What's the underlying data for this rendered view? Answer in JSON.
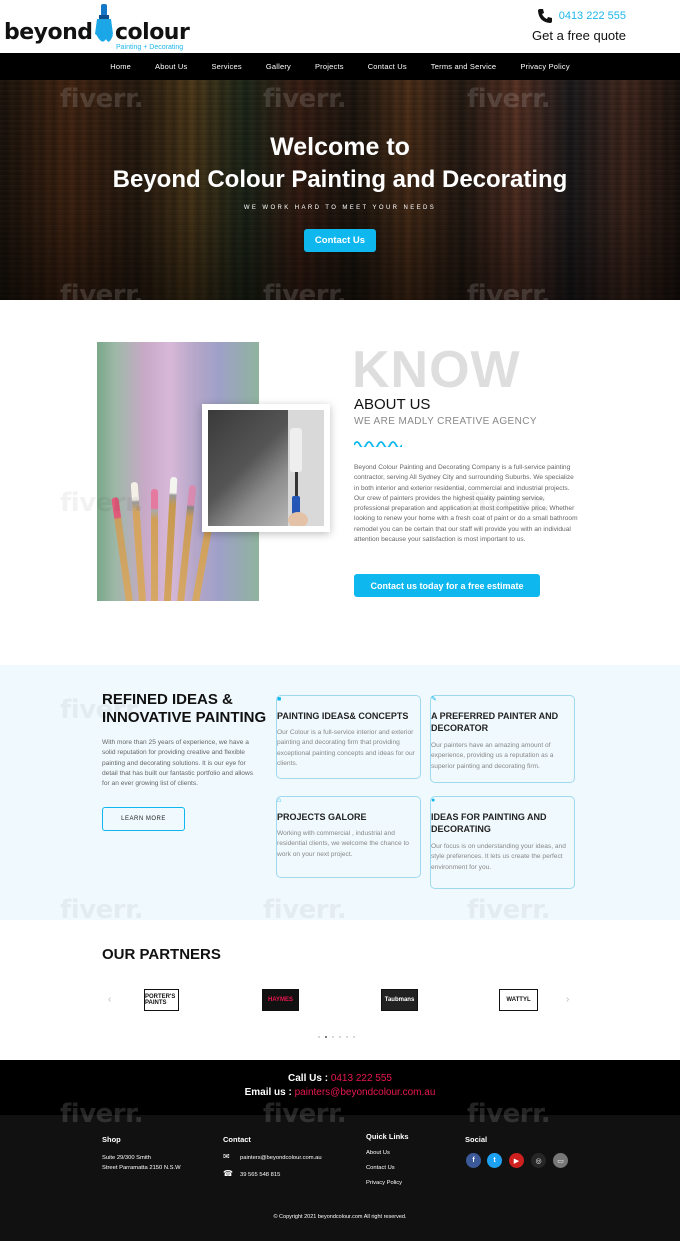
{
  "header": {
    "logo_word1": "beyond",
    "logo_word2": "colour",
    "logo_tagline": "Painting + Decorating",
    "phone": "0413 222 555",
    "quote": "Get a free quote"
  },
  "nav": [
    "Home",
    "About Us",
    "Services",
    "Gallery",
    "Projects",
    "Contact Us",
    "Terms and Service",
    "Privacy Policy"
  ],
  "hero": {
    "title_line1": "Welcome to",
    "title_line2": "Beyond Colour Painting and Decorating",
    "subtitle": "WE WORK HARD TO MEET YOUR NEEDS",
    "button": "Contact Us"
  },
  "about": {
    "bg_word": "KNOW",
    "heading": "ABOUT US",
    "subheading": "WE ARE MADLY CREATIVE AGENCY",
    "body": "Beyond Colour Painting and Decorating Company is a full-service painting contractor, serving All Sydney City and surrounding Suburbs. We specialize in both interior and exterior residential, commercial and industrial projects. Our crew of painters provides the highest quality painting service, professional preparation and application at most competitive price. Whether looking to renew your home with a fresh coat of paint or do a small bathroom remodel you can be certain that our staff will provide you with an individual attention because your satisfaction is most important to us.",
    "button": "Contact us today for a free estimate"
  },
  "ideas": {
    "title_line1": "REFINED IDEAS &",
    "title_line2": "INNOVATIVE PAINTING",
    "body": "With more than 25 years of experience, we have a solid reputation for providing creative and flexible painting and decorating solutions. It is our eye for detail that has built our fantastic portfolio and allows for an ever growing list of clients.",
    "button": "LEARN MORE",
    "cards": [
      {
        "title": "PAINTING IDEAS& CONCEPTS",
        "body": "Our Colour is a full-service interior and exterior painting and decorating firm that providing exceptional painting concepts and ideas for our clients."
      },
      {
        "title": "A PREFERRED PAINTER AND DECORATOR",
        "body": "Our painters have an amazing amount of experience, providing us a reputation as a superior painting and decorating firm."
      },
      {
        "title": "PROJECTS GALORE",
        "body": "Working with commercial , industrial and residential clients, we welcome the chance to work on your next project."
      },
      {
        "title": "IDEAS FOR PAINTING AND DECORATING",
        "body": "Our focus is on understanding your ideas, and style preferences. It lets us create the perfect environment for you."
      }
    ]
  },
  "partners": {
    "title": "OUR PARTNERS",
    "logos": [
      "PORTER'S PAINTS",
      "HAYMES",
      "Taubmans",
      "WATTYL"
    ]
  },
  "contact_band": {
    "call_label": "Call Us :",
    "call_value": "0413 222 555",
    "email_label": "Email us :",
    "email_value": "painters@beyondcolour.com.au"
  },
  "footer": {
    "shop_title": "Shop",
    "shop_line1": "Suite 29/300 Smith",
    "shop_line2": "Street Parramatta 2150 N.S.W",
    "contact_title": "Contact",
    "contact_email": "painters@beyondcolour.com.au",
    "contact_phone": "39 565 548 815",
    "links_title": "Quick Links",
    "links": [
      "About Us",
      "Contact Us",
      "Privacy Policy"
    ],
    "social_title": "Social",
    "copyright": "© Copyright 2021 beyondcolour.com All right reserved."
  },
  "watermark": "fiverr.",
  "colors": {
    "accent": "#0fb7ef",
    "pink": "#e8174f",
    "dark": "#111111"
  }
}
